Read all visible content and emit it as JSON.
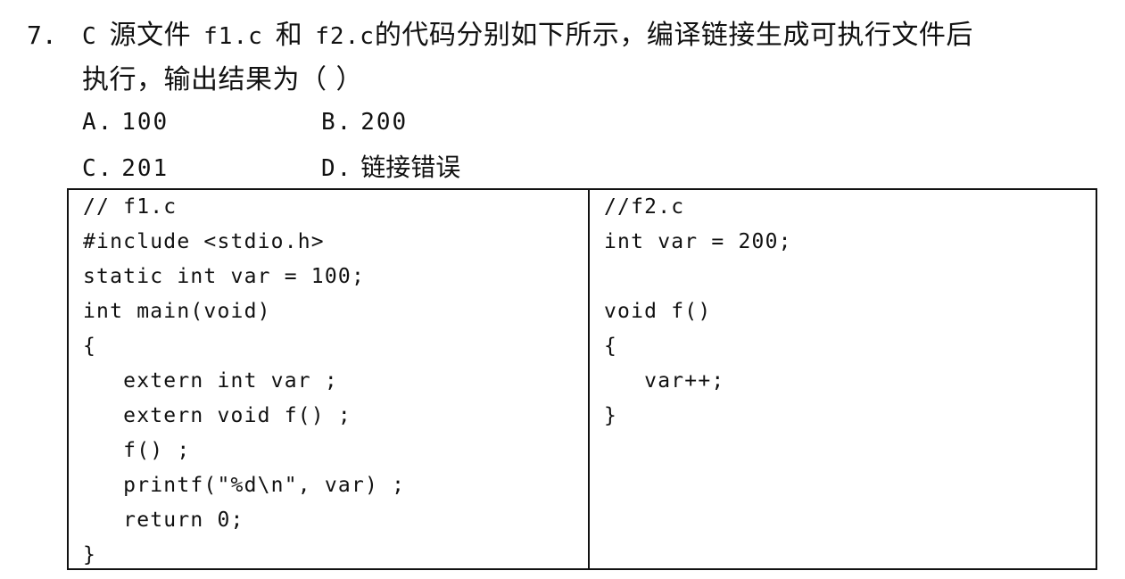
{
  "question": {
    "number": "7.",
    "line1_parts": [
      {
        "text": "C",
        "mono": true
      },
      {
        "text": "源文件",
        "mono": false
      },
      {
        "text": "f1.c",
        "mono": true
      },
      {
        "text": "和",
        "mono": false
      },
      {
        "text": "f2.c",
        "mono": true
      },
      {
        "text": "的代码分别如下所示，编译链接生成可执行文件后",
        "mono": false
      }
    ],
    "line2": "执行，输出结果为（ ）"
  },
  "options": {
    "a": {
      "letter": "A.",
      "value": "100"
    },
    "b": {
      "letter": "B.",
      "value": "200"
    },
    "c": {
      "letter": "C.",
      "value": "201"
    },
    "d": {
      "letter": "D.",
      "value": "链接错误"
    }
  },
  "code": {
    "left": [
      "// f1.c",
      "#include <stdio.h>",
      "static int var = 100;",
      "int main(void)",
      "{",
      "   extern int var ;",
      "   extern void f() ;",
      "   f() ;",
      "   printf(\"%d\\n\", var) ;",
      "   return 0;",
      "}"
    ],
    "right": [
      "//f2.c",
      "int var = 200;",
      "",
      "void f()",
      "{",
      "   var++;",
      "}"
    ]
  }
}
